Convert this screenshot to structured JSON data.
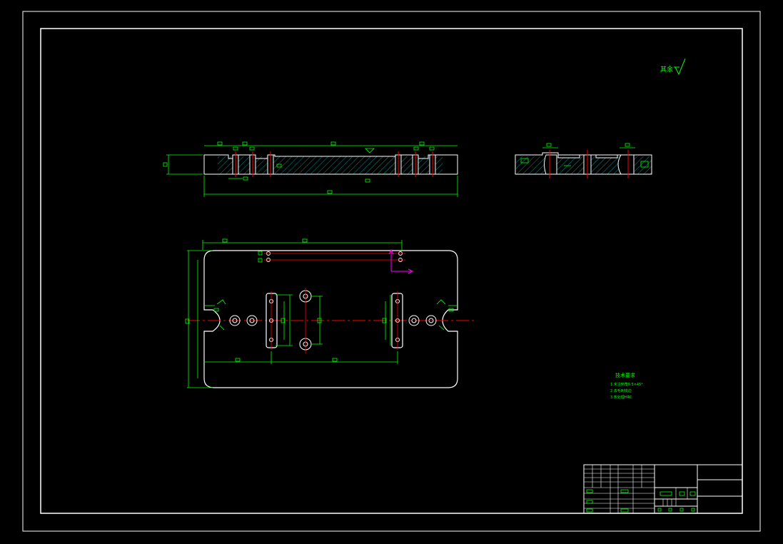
{
  "colors": {
    "background": "#000000",
    "frame": "#ffffff",
    "dimension": "#00ff00",
    "centerline": "#ff0000",
    "hatch": "#00ffff",
    "ucs": "#ff00ff",
    "label_box": "#00ff00"
  },
  "roughness_symbol_text": "其余",
  "technical_requirements": {
    "title": "技术要求",
    "lines": [
      "1.未注倒角0.5×45°",
      "2.去毛刺锐边",
      "3.热处理HRC"
    ]
  },
  "title_block": {
    "cells": []
  }
}
